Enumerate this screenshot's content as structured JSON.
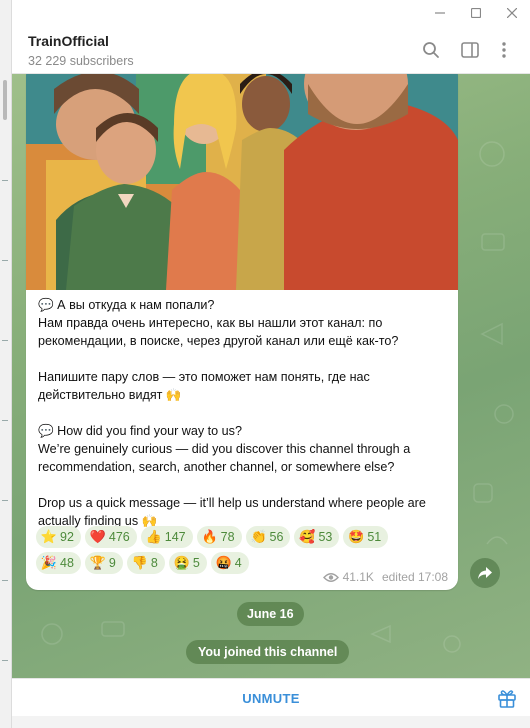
{
  "header": {
    "channel_name": "TrainOfficial",
    "subscribers": "32 229 subscribers"
  },
  "icons": {
    "search": "search-icon",
    "sidebar": "sidebar-toggle-icon",
    "more": "more-vertical-icon",
    "minimize": "minimize-icon",
    "maximize": "maximize-icon",
    "close": "close-icon",
    "share": "share-icon",
    "gift": "gift-icon",
    "views": "eye-icon"
  },
  "message": {
    "ru_title": "💬 А вы откуда к нам попали?",
    "ru_body": "Нам правда очень интересно, как вы нашли этот канал: по рекомендации, в поиске, через другой канал или ещё как-то?",
    "ru_cta": "Напишите пару слов — это поможет нам понять, где нас действительно видят 🙌",
    "en_title": "💬 How did you find your way to us?",
    "en_body": "We’re genuinely curious — did you discover this channel through a recommendation, search, another channel, or somewhere else?",
    "en_cta": "Drop us a quick message — it’ll help us understand where people are actually finding us 🙌",
    "views": "41.1K",
    "edited": "edited 17:08"
  },
  "reactions": [
    {
      "emoji": "⭐",
      "count": "92"
    },
    {
      "emoji": "❤️",
      "count": "476"
    },
    {
      "emoji": "👍",
      "count": "147"
    },
    {
      "emoji": "🔥",
      "count": "78"
    },
    {
      "emoji": "👏",
      "count": "56"
    },
    {
      "emoji": "🥰",
      "count": "53"
    },
    {
      "emoji": "🤩",
      "count": "51"
    },
    {
      "emoji": "🎉",
      "count": "48"
    },
    {
      "emoji": "🏆",
      "count": "9"
    },
    {
      "emoji": "👎",
      "count": "8"
    },
    {
      "emoji": "🤮",
      "count": "5"
    },
    {
      "emoji": "🤬",
      "count": "4"
    }
  ],
  "date_separator": "June 16",
  "service_message": "You joined this channel",
  "bottom": {
    "unmute_label": "UNMUTE"
  },
  "colors": {
    "accent": "#3a8fd9",
    "reaction_bg": "#e8f1e0",
    "reaction_text": "#4d8a3b",
    "chat_bg": "#87ae79"
  }
}
